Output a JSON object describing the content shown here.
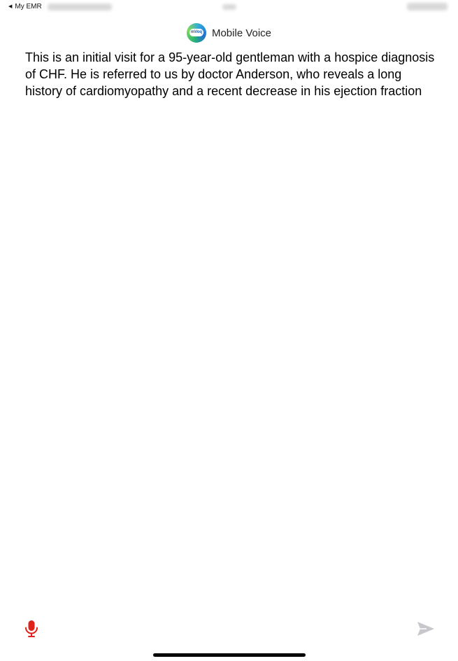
{
  "status_bar": {
    "back_label": "My EMR",
    "back_icon": "chevron-left-icon"
  },
  "header": {
    "logo_text": "mVoq",
    "title": "Mobile Voice"
  },
  "note": {
    "text": "This is an initial visit for a 95-year-old gentleman with a hospice diagnosis of CHF. He is referred to us by doctor Anderson, who reveals a long history of cardiomyopathy and a recent decrease in his ejection fraction"
  },
  "toolbar": {
    "mic_icon": "microphone-icon",
    "send_icon": "send-icon"
  },
  "colors": {
    "mic": "#e0221b",
    "send_disabled": "#c7c7cc"
  }
}
